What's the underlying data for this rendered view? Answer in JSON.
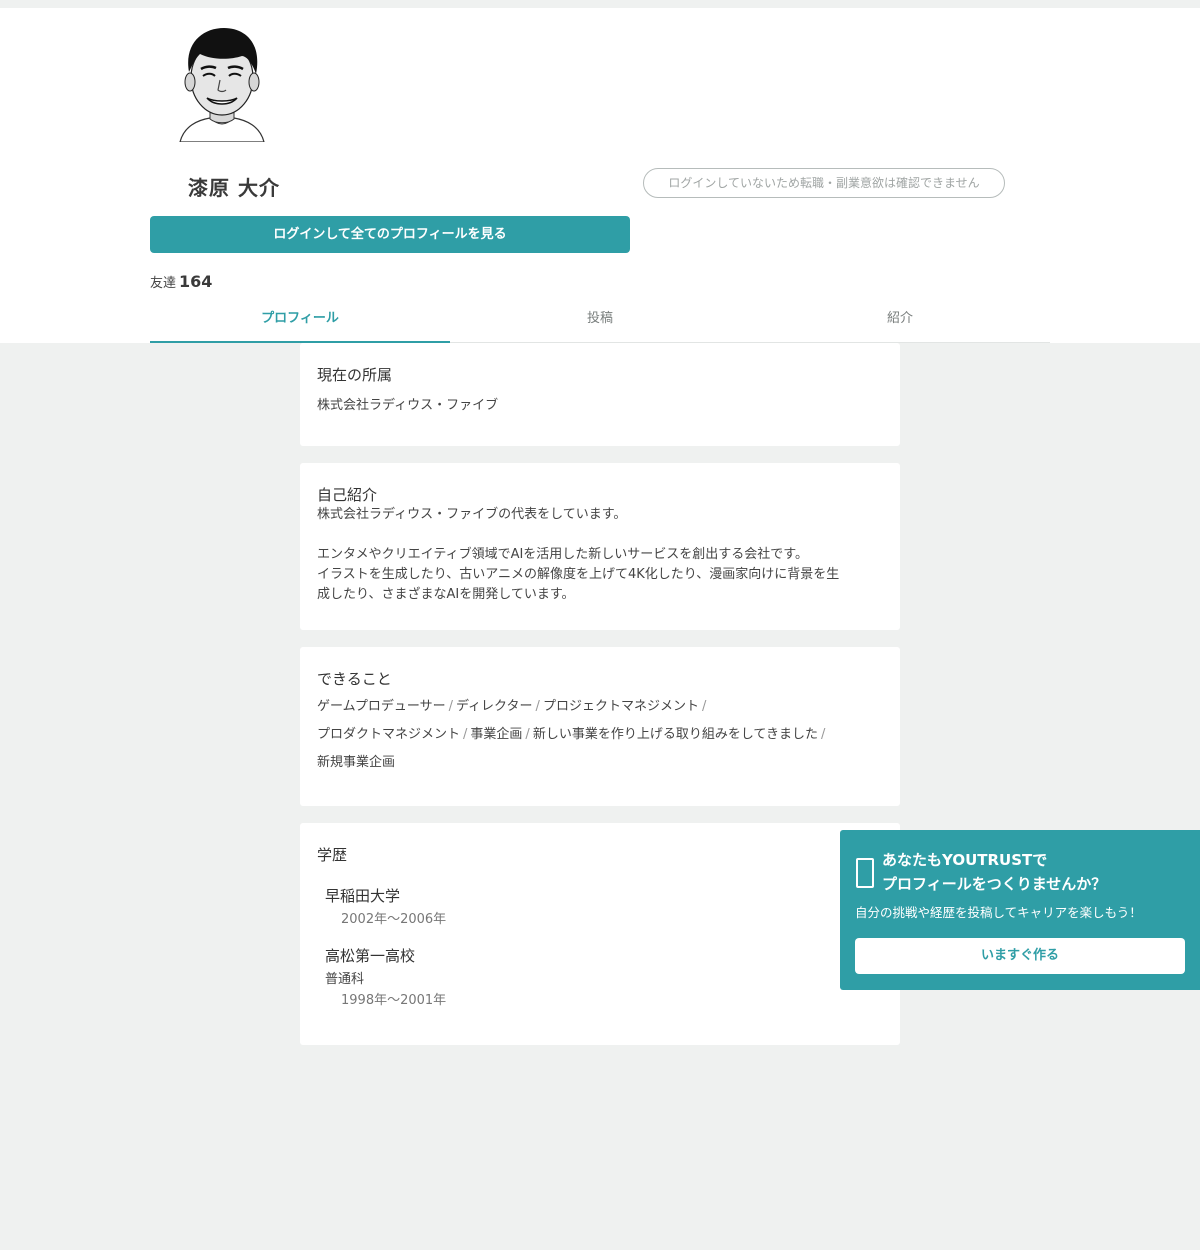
{
  "profile": {
    "name": "漆原 大介",
    "job_status": "ログインしていないため転職・副業意欲は確認できません",
    "login_button": "ログインして全てのプロフィールを見る",
    "friends_label": "友達",
    "friends_count": "164"
  },
  "tabs": [
    {
      "label": "プロフィール",
      "active": true
    },
    {
      "label": "投稿",
      "active": false
    },
    {
      "label": "紹介",
      "active": false
    }
  ],
  "affiliation": {
    "title": "現在の所属",
    "value": "株式会社ラディウス・ファイブ"
  },
  "intro": {
    "title": "自己紹介",
    "line1": "株式会社ラディウス・ファイブの代表をしています。",
    "line2": "エンタメやクリエイティブ領域でAIを活用した新しいサービスを創出する会社です。",
    "line3": "イラストを生成したり、古いアニメの解像度を上げて4K化したり、漫画家向けに背景を生",
    "line4": "成したり、さまざまなAIを開発しています。"
  },
  "skills": {
    "title": "できること",
    "items": [
      "ゲームプロデューサー",
      "ディレクター",
      "プロジェクトマネジメント",
      "プロダクトマネジメント",
      "事業企画",
      "新しい事業を作り上げる取り組みをしてきました",
      "新規事業企画"
    ],
    "separator": "/"
  },
  "education": {
    "title": "学歴",
    "schools": [
      {
        "name": "早稲田大学",
        "dept": "",
        "period": "2002年〜2006年"
      },
      {
        "name": "高松第一高校",
        "dept": "普通科",
        "period": "1998年〜2001年"
      }
    ]
  },
  "cta": {
    "title_line1": "あなたもYOUTRUSTで",
    "title_line2": "プロフィールをつくりませんか？",
    "subtitle": "自分の挑戦や経歴を投稿してキャリアを楽しもう！",
    "button": "いますぐ作る"
  },
  "colors": {
    "accent": "#2f9ea6",
    "background": "#eff1f0"
  }
}
